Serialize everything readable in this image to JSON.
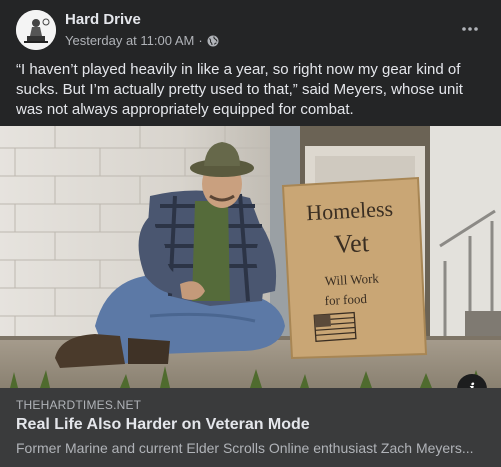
{
  "post": {
    "page_name": "Hard Drive",
    "timestamp": "Yesterday at 11:00 AM",
    "separator": "·",
    "audience_icon": "globe-icon",
    "more_icon": "more-options-icon",
    "text": "“I haven’t played heavily in like a year, so right now my gear kind of sucks. But I’m actually pretty used to that,” said Meyers, whose unit was not always appropriately equipped for combat."
  },
  "image": {
    "sign_line1": "Homeless",
    "sign_line2": "Vet",
    "sign_line3": "Will Work",
    "sign_line4": "for food",
    "info_icon_label": "i"
  },
  "link": {
    "domain": "THEHARDTIMES.NET",
    "headline": "Real Life Also Harder on Veteran Mode",
    "description": "Former Marine and current Elder Scrolls Online enthusiast Zach Meyers..."
  }
}
